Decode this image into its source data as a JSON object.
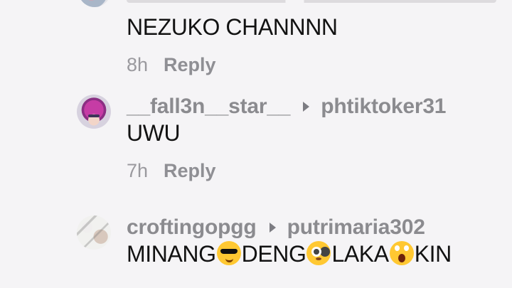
{
  "comments": [
    {
      "message": "NEZUKO CHANNNN",
      "time": "8h",
      "reply_label": "Reply"
    },
    {
      "username": "__fall3n__star__",
      "reply_to": "phtiktoker31",
      "message": "UWU",
      "time": "7h",
      "reply_label": "Reply"
    },
    {
      "username": "croftingopgg",
      "reply_to": "putrimaria302",
      "message_parts": [
        "MINANG",
        "DENG",
        "LAKA",
        "KIN"
      ]
    }
  ],
  "icons": {
    "reply_arrow": "caret-right-icon",
    "emoji_1": "sunglasses-emoji-icon",
    "emoji_2": "flushed-emoji-icon",
    "emoji_3": "screaming-emoji-icon"
  },
  "colors": {
    "background": "#f5f4f6",
    "message_text": "#121212",
    "meta_text": "#9a999e"
  }
}
